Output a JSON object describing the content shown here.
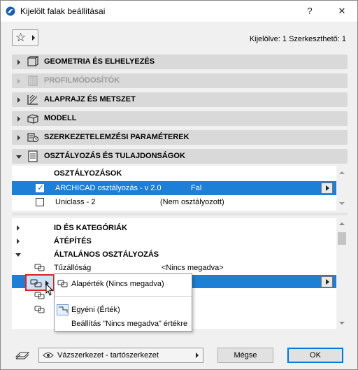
{
  "window": {
    "title": "Kijelölt falak beállításai",
    "help": "?",
    "close": "✕"
  },
  "favorites": {
    "icon": "star-icon"
  },
  "selection_info": "Kijelölve: 1 Szerkeszthető: 1",
  "panels": [
    {
      "label": "GEOMETRIA ÉS ELHELYEZÉS",
      "icon": "geometry-icon",
      "enabled": true,
      "expanded": false
    },
    {
      "label": "PROFILMÓDOSÍTÓK",
      "icon": "profile-modifier-icon",
      "enabled": false,
      "expanded": false
    },
    {
      "label": "ALAPRAJZ ÉS METSZET",
      "icon": "floorplan-section-icon",
      "enabled": true,
      "expanded": false
    },
    {
      "label": "MODELL",
      "icon": "model-icon",
      "enabled": true,
      "expanded": false
    },
    {
      "label": "SZERKEZETELEMZÉSI PARAMÉTEREK",
      "icon": "structural-analysis-icon",
      "enabled": true,
      "expanded": false
    },
    {
      "label": "OSZTÁLYOZÁS ÉS TULAJDONSÁGOK",
      "icon": "classification-icon",
      "enabled": true,
      "expanded": true
    }
  ],
  "classifications": {
    "header": "OSZTÁLYOZÁSOK",
    "rows": [
      {
        "checked": true,
        "name": "ARCHICAD osztályozás - v 2.0",
        "value": "Fal",
        "selected": true
      },
      {
        "checked": false,
        "name": "Uniclass - 2",
        "value": "(Nem osztályozott)",
        "selected": false
      }
    ]
  },
  "tree": {
    "groups": [
      {
        "label": "ID ÉS KATEGÓRIÁK",
        "expanded": false
      },
      {
        "label": "ÁTÉPÍTÉS",
        "expanded": false
      },
      {
        "label": "ÁLTALÁNOS OSZTÁLYOZÁS",
        "expanded": true
      }
    ],
    "properties": [
      {
        "name": "Tűzállóság",
        "value": "<Nincs megadva>",
        "selected": false
      },
      {
        "name": "",
        "value": "",
        "selected": true
      },
      {
        "name": "",
        "value": "",
        "selected": false
      },
      {
        "name": "",
        "value": "",
        "selected": false
      }
    ]
  },
  "popup_menu": {
    "items": [
      {
        "label": "Alapérték (Nincs megadva)",
        "icon": "property-default-icon"
      },
      {
        "label": "Egyéni (Érték)",
        "icon": "property-custom-icon"
      },
      {
        "label": "Beállítás \"Nincs megadva\" értékre",
        "icon": ""
      }
    ]
  },
  "bottom": {
    "layer": "Vázszerkezet - tartószerkezet",
    "cancel": "Mégse",
    "ok": "OK"
  },
  "colors": {
    "selection": "#1e7fd6",
    "highlight_border": "#e02020",
    "panel": "#d9d9d9"
  }
}
